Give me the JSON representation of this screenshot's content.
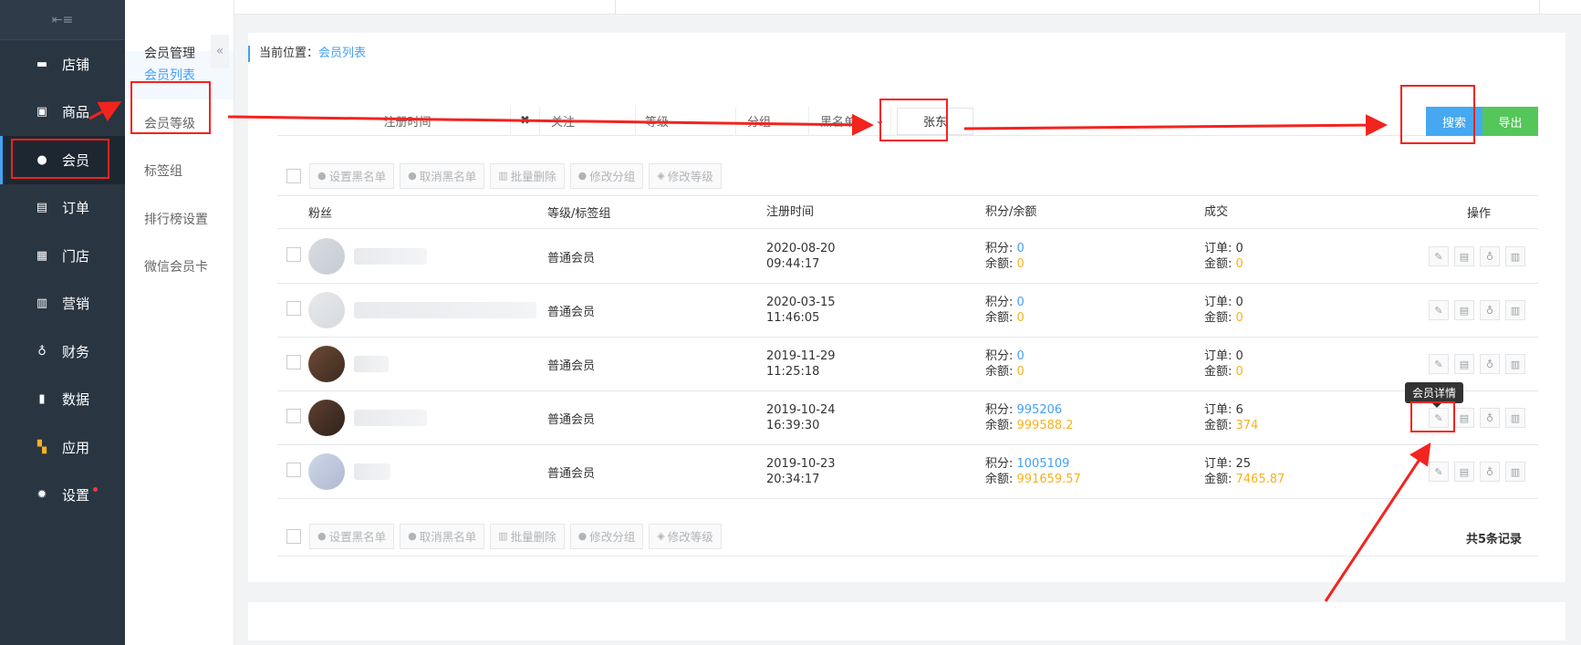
{
  "sidebar": {
    "collapse_icon": "menu-collapse-icon",
    "items": [
      {
        "label": "店铺",
        "icon": "store-icon"
      },
      {
        "label": "商品",
        "icon": "goods-icon"
      },
      {
        "label": "会员",
        "icon": "user-icon"
      },
      {
        "label": "订单",
        "icon": "order-icon"
      },
      {
        "label": "门店",
        "icon": "shop-icon"
      },
      {
        "label": "营销",
        "icon": "gift-icon"
      },
      {
        "label": "财务",
        "icon": "money-bag-icon"
      },
      {
        "label": "数据",
        "icon": "bar-chart-icon"
      },
      {
        "label": "应用",
        "icon": "apps-icon"
      },
      {
        "label": "设置",
        "icon": "gear-icon"
      }
    ],
    "active_index": 2
  },
  "subnav": {
    "title": "会员管理",
    "items": [
      "会员列表",
      "会员等级",
      "标签组",
      "排行榜设置",
      "微信会员卡"
    ],
    "active_index": 0,
    "fold_glyph": "«"
  },
  "breadcrumb": {
    "prefix": "当前位置：",
    "current": "会员列表"
  },
  "filters": {
    "register_time": "注册时间",
    "clear_glyph": "✖",
    "follow": "关注",
    "level": "等级",
    "group": "分组",
    "blacklist": "黑名单",
    "blacklist_arrow": "⌄",
    "name_value": "张东",
    "search_label": "搜索",
    "export_label": "导出"
  },
  "toolbar": {
    "set_blacklist": "设置黑名单",
    "cancel_blacklist": "取消黑名单",
    "batch_delete": "批量删除",
    "modify_group": "修改分组",
    "modify_level": "修改等级"
  },
  "table": {
    "headers": {
      "fans": "粉丝",
      "level": "等级/标签组",
      "register_time": "注册时间",
      "points_balance": "积分/余额",
      "deal": "成交",
      "ops": "操作"
    },
    "points_label": "积分: ",
    "balance_label": "余额: ",
    "order_label": "订单: ",
    "amount_label": "金额: ",
    "rows": [
      {
        "level": "普通会员",
        "date": "2020-08-20",
        "time": "09:44:17",
        "points": "0",
        "balance": "0",
        "orders": "0",
        "amount": "0"
      },
      {
        "level": "普通会员",
        "date": "2020-03-15",
        "time": "11:46:05",
        "points": "0",
        "balance": "0",
        "orders": "0",
        "amount": "0"
      },
      {
        "level": "普通会员",
        "date": "2019-11-29",
        "time": "11:25:18",
        "points": "0",
        "balance": "0",
        "orders": "0",
        "amount": "0"
      },
      {
        "level": "普通会员",
        "date": "2019-10-24",
        "time": "16:39:30",
        "points": "995206",
        "balance": "999588.2",
        "orders": "6",
        "amount": "374"
      },
      {
        "level": "普通会员",
        "date": "2019-10-23",
        "time": "20:34:17",
        "points": "1005109",
        "balance": "991659.57",
        "orders": "25",
        "amount": "7465.87"
      }
    ],
    "total": "共5条记录"
  },
  "tooltip": "会员详情",
  "colors": {
    "accent": "#45a0f5",
    "orange": "#f5b21e",
    "annotation": "#f3231e",
    "sidebar_bg": "#2a3542"
  }
}
